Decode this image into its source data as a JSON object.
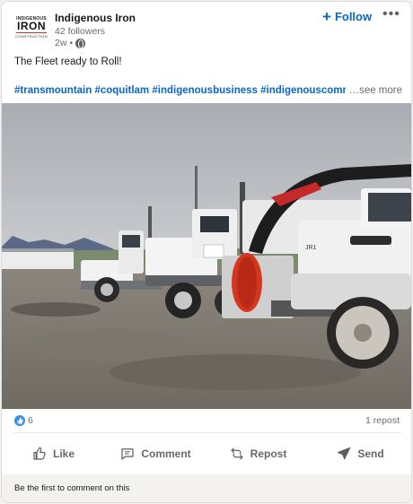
{
  "post": {
    "author": {
      "name": "Indigenous Iron",
      "followers": "42 followers",
      "time": "2w",
      "separator": "•",
      "logo": {
        "line1": "INDIGENOUS",
        "line2": "IRON",
        "line3": "CONSTRUCTION"
      }
    },
    "follow_label": "Follow",
    "more_icon": "more-horizontal-icon",
    "text": "The Fleet ready to Roll!",
    "hashtags": "#transmountain #coquitlam #indigenousbusiness #indigenouscommunity",
    "see_more": "…see more",
    "image": {
      "description_icon": "photo-trucks",
      "truck_labels": {
        "front_truck": "JR1"
      }
    },
    "reactions": {
      "count": "6",
      "icon": "like-reaction-icon"
    },
    "reposts": "1 repost",
    "actions": [
      {
        "label": "Like",
        "icon": "thumbs-up-icon"
      },
      {
        "label": "Comment",
        "icon": "comment-icon"
      },
      {
        "label": "Repost",
        "icon": "repost-icon"
      },
      {
        "label": "Send",
        "icon": "send-icon"
      }
    ],
    "comments_prompt": "Be the first to comment on this"
  },
  "colors": {
    "accent": "#0a66c2",
    "like_blue": "#378fe9",
    "muted_text": "#00000099"
  }
}
